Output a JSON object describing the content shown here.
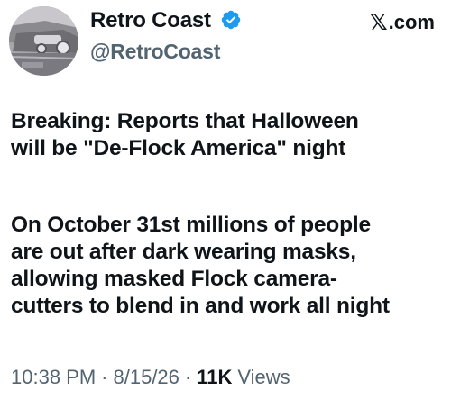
{
  "author": {
    "display_name": "Retro Coast",
    "handle": "@RetroCoast",
    "verified": true,
    "verified_color": "#1d9bf0"
  },
  "source": {
    "logo_glyph": "𝕏",
    "domain": ".com"
  },
  "tweet": {
    "paragraphs": [
      [
        "Breaking: Reports that Halloween",
        "will be \"De-Flock America\" night"
      ],
      [
        "On October 31st millions of people",
        "are out after dark wearing masks,",
        "allowing masked Flock camera-",
        "cutters to blend in and work all night"
      ]
    ]
  },
  "meta": {
    "time": "10:38 PM",
    "separator": "·",
    "date": "8/15/26",
    "views_count": "11K",
    "views_label": "Views"
  },
  "icons": {
    "avatar": "vintage-car-photo",
    "verified": "verified-badge-icon"
  }
}
